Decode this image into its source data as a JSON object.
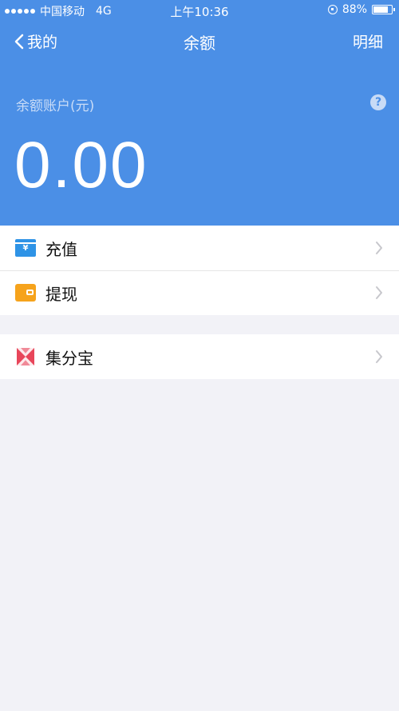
{
  "status_bar": {
    "carrier": "中国移动",
    "network": "4G",
    "time": "上午10:36",
    "battery": "88%"
  },
  "nav": {
    "back_label": "我的",
    "title": "余额",
    "right_label": "明细"
  },
  "account": {
    "label": "余额账户(元)",
    "balance": "0.00",
    "help_glyph": "?"
  },
  "menu": {
    "recharge_label": "充值",
    "recharge_glyph": "¥",
    "withdraw_label": "提现",
    "jifen_label": "集分宝"
  },
  "colors": {
    "header": "#4b8fe6",
    "background": "#f2f2f7",
    "recharge_icon": "#2e93e6",
    "withdraw_icon": "#f6a31c",
    "jifen_icon": "#e8465a"
  }
}
